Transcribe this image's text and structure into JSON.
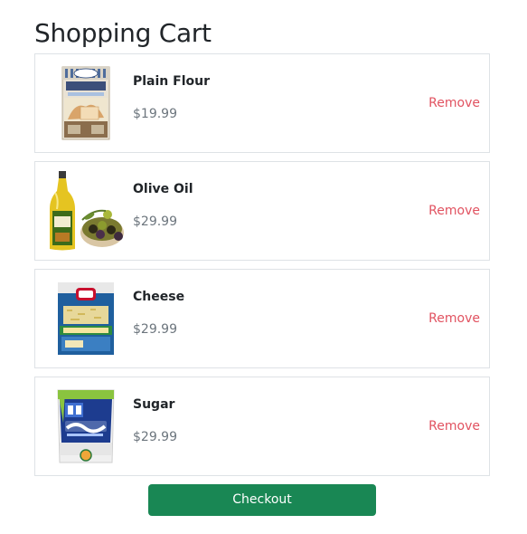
{
  "page": {
    "title": "Shopping Cart"
  },
  "cart": {
    "items": [
      {
        "name": "Plain Flour",
        "price": "$19.99",
        "remove_label": "Remove",
        "image_icon": "flour-box-icon"
      },
      {
        "name": "Olive Oil",
        "price": "$29.99",
        "remove_label": "Remove",
        "image_icon": "olive-oil-bottle-icon"
      },
      {
        "name": "Cheese",
        "price": "$29.99",
        "remove_label": "Remove",
        "image_icon": "cheese-bag-icon"
      },
      {
        "name": "Sugar",
        "price": "$29.99",
        "remove_label": "Remove",
        "image_icon": "sugar-bag-icon"
      }
    ]
  },
  "checkout": {
    "label": "Checkout"
  },
  "colors": {
    "accent": "#198754",
    "remove": "#dc3545",
    "price": "#6c757d",
    "border": "#dee2e6"
  }
}
